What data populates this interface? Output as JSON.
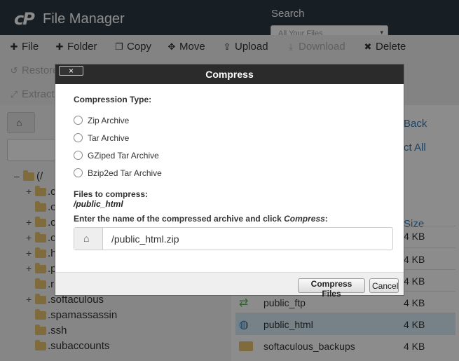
{
  "header": {
    "logo": "cP",
    "app_title": "File Manager",
    "search_label": "Search",
    "search_select_value": "All Your Files"
  },
  "toolbar": {
    "row1": [
      {
        "icon": "plus-icon",
        "label": "File"
      },
      {
        "icon": "plus-icon",
        "label": "Folder"
      },
      {
        "icon": "copy-icon",
        "label": "Copy"
      },
      {
        "icon": "move-icon",
        "label": "Move"
      },
      {
        "icon": "upload-icon",
        "label": "Upload"
      },
      {
        "icon": "download-icon",
        "label": "Download"
      },
      {
        "icon": "close-icon",
        "label": "Delete"
      }
    ],
    "row2": [
      {
        "icon": "undo-icon",
        "label": "Restore"
      },
      {
        "icon": "expand-icon",
        "label": "Extract"
      }
    ]
  },
  "tree": {
    "rows": [
      {
        "expand": "–",
        "name": "(/"
      },
      {
        "expand": "+",
        "name": ".c"
      },
      {
        "expand": "",
        "name": ".c"
      },
      {
        "expand": "+",
        "name": ".c"
      },
      {
        "expand": "+",
        "name": ".c"
      },
      {
        "expand": "+",
        "name": ".h"
      },
      {
        "expand": "+",
        "name": ".p"
      },
      {
        "expand": "",
        "name": ".r"
      },
      {
        "expand": "+",
        "name": ".softaculous"
      },
      {
        "expand": "",
        "name": ".spamassassin"
      },
      {
        "expand": "",
        "name": ".ssh"
      },
      {
        "expand": "",
        "name": ".subaccounts"
      }
    ]
  },
  "right_panel": {
    "back_label": "Back",
    "select_all_label": "ct All",
    "size_header": "Size",
    "files": [
      {
        "name": "",
        "size": "4 KB",
        "icon": "folder-icon",
        "selected": false
      },
      {
        "name": "",
        "size": "4 KB",
        "icon": "folder-icon",
        "selected": false
      },
      {
        "name": "",
        "size": "4 KB",
        "icon": "folder-icon",
        "selected": false
      },
      {
        "name": "public_ftp",
        "size": "4 KB",
        "icon": "transfer-icon",
        "selected": false
      },
      {
        "name": "public_html",
        "size": "4 KB",
        "icon": "globe-icon",
        "selected": true
      },
      {
        "name": "softaculous_backups",
        "size": "4 KB",
        "icon": "folder-icon",
        "selected": false
      }
    ]
  },
  "dialog": {
    "title": "Compress",
    "close_label": "×",
    "compression_type_label": "Compression Type:",
    "options": [
      {
        "label": "Zip Archive",
        "checked": false
      },
      {
        "label": "Tar Archive",
        "checked": false
      },
      {
        "label": "GZiped Tar Archive",
        "checked": false
      },
      {
        "label": "Bzip2ed Tar Archive",
        "checked": false
      }
    ],
    "files_label": "Files to compress:",
    "files_value": "/public_html",
    "prompt_before": "Enter the name of the compressed archive and click ",
    "prompt_em": "Compress",
    "prompt_after": ":",
    "archive_name": "/public_html.zip",
    "compress_button": "Compress Files",
    "cancel_button": "Cancel"
  }
}
